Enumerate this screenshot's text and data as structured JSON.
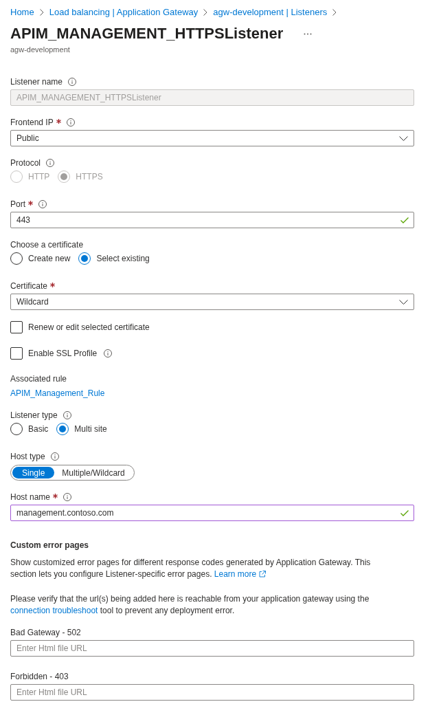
{
  "breadcrumb": [
    {
      "label": "Home"
    },
    {
      "label": "Load balancing | Application Gateway"
    },
    {
      "label": "agw-development | Listeners"
    }
  ],
  "header": {
    "title": "APIM_MANAGEMENT_HTTPSListener",
    "subtitle": "agw-development"
  },
  "fields": [
    {
      "kind": "text",
      "label": "Listener name",
      "required": false,
      "info": true,
      "value": "APIM_MANAGEMENT_HTTPSListener",
      "disabled": true,
      "valid": false,
      "focused": false
    },
    {
      "kind": "select",
      "label": "Frontend IP",
      "required": true,
      "info": true,
      "value": "Public"
    },
    {
      "kind": "radio",
      "label": "Protocol",
      "required": false,
      "info": true,
      "disabled": true,
      "options": [
        {
          "label": "HTTP",
          "selected": false
        },
        {
          "label": "HTTPS",
          "selected": true
        }
      ]
    },
    {
      "kind": "text",
      "label": "Port",
      "required": true,
      "info": true,
      "value": "443",
      "disabled": false,
      "valid": true,
      "focused": false
    },
    {
      "kind": "radio",
      "label": "Choose a certificate",
      "required": false,
      "info": false,
      "disabled": false,
      "options": [
        {
          "label": "Create new",
          "selected": false
        },
        {
          "label": "Select existing",
          "selected": true
        }
      ]
    },
    {
      "kind": "select",
      "label": "Certificate",
      "required": true,
      "info": false,
      "value": "Wildcard"
    },
    {
      "kind": "checkbox",
      "label": "Renew or edit selected certificate",
      "info": false,
      "checked": false
    },
    {
      "kind": "checkbox",
      "label": "Enable SSL Profile",
      "info": true,
      "checked": false
    },
    {
      "kind": "link",
      "label": "Associated rule",
      "required": false,
      "info": false,
      "link": "APIM_Management_Rule"
    },
    {
      "kind": "radio",
      "label": "Listener type",
      "required": false,
      "info": true,
      "disabled": false,
      "options": [
        {
          "label": "Basic",
          "selected": false
        },
        {
          "label": "Multi site",
          "selected": true
        }
      ]
    },
    {
      "kind": "toggle",
      "label": "Host type",
      "required": false,
      "info": true,
      "options": [
        {
          "label": "Single",
          "selected": true
        },
        {
          "label": "Multiple/Wildcard",
          "selected": false
        }
      ]
    },
    {
      "kind": "text",
      "label": "Host name",
      "required": true,
      "info": true,
      "value": "management.contoso.com",
      "disabled": false,
      "valid": true,
      "focused": true
    }
  ],
  "custom_error_pages": {
    "heading": "Custom error pages",
    "description": "Show customized error pages for different response codes generated by Application Gateway. This section lets you configure Listener-specific error pages.",
    "learn_more": "Learn more",
    "notice_before": "Please verify that the url(s) being added here is reachable from your application gateway using the",
    "notice_link": "connection troubleshoot",
    "notice_after": "tool to prevent any deployment error.",
    "fields": [
      {
        "label": "Bad Gateway - 502",
        "placeholder": "Enter Html file URL"
      },
      {
        "label": "Forbidden - 403",
        "placeholder": "Enter Html file URL"
      }
    ]
  }
}
